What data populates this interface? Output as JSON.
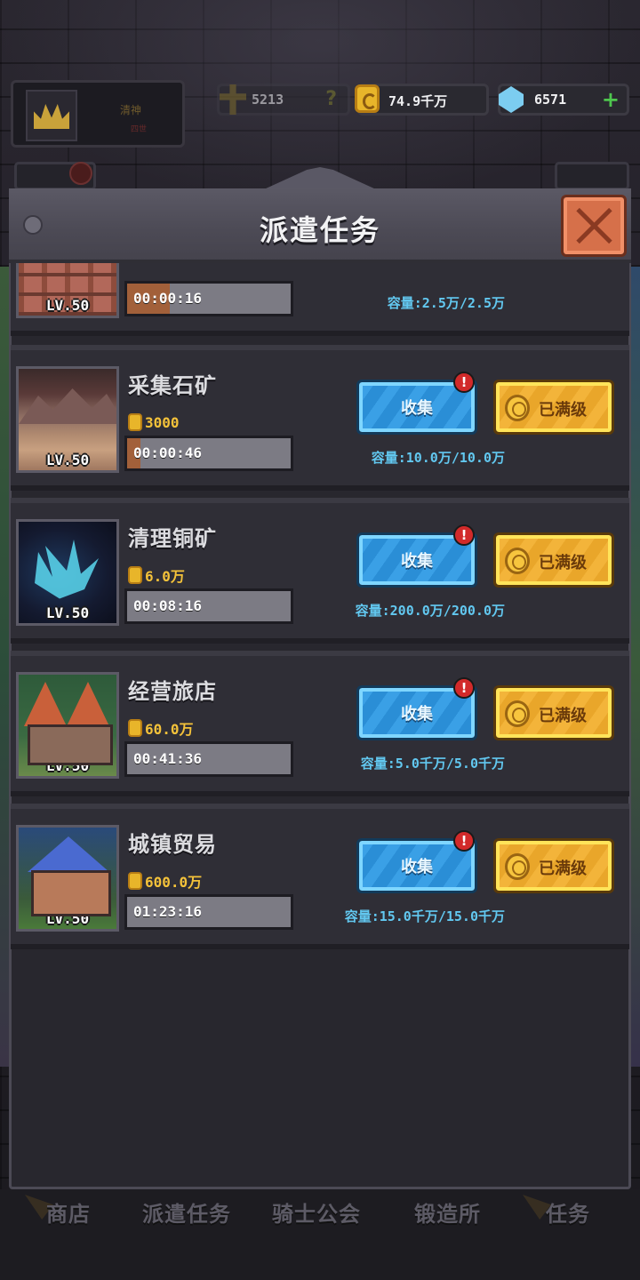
{
  "hud": {
    "profile_name": "清神",
    "profile_sub": "四世",
    "power": "5213",
    "gold": "74.9千万",
    "gems": "6571"
  },
  "modal": {
    "title": "派遣任务"
  },
  "tasks": [
    {
      "name": "",
      "level": "LV.50",
      "cost": "",
      "timer": "00:00:16",
      "timer_progress": 0.26,
      "capacity": "容量:2.5万/2.5万",
      "collect_label": "收集",
      "max_label": "已满级"
    },
    {
      "name": "采集石矿",
      "level": "LV.50",
      "cost": "3000",
      "timer": "00:00:46",
      "timer_progress": 0.08,
      "capacity": "容量:10.0万/10.0万",
      "collect_label": "收集",
      "max_label": "已满级"
    },
    {
      "name": "清理铜矿",
      "level": "LV.50",
      "cost": "6.0万",
      "timer": "00:08:16",
      "timer_progress": 0,
      "capacity": "容量:200.0万/200.0万",
      "collect_label": "收集",
      "max_label": "已满级"
    },
    {
      "name": "经营旅店",
      "level": "LV.50",
      "cost": "60.0万",
      "timer": "00:41:36",
      "timer_progress": 0,
      "capacity": "容量:5.0千万/5.0千万",
      "collect_label": "收集",
      "max_label": "已满级"
    },
    {
      "name": "城镇贸易",
      "level": "LV.50",
      "cost": "600.0万",
      "timer": "01:23:16",
      "timer_progress": 0,
      "capacity": "容量:15.0千万/15.0千万",
      "collect_label": "收集",
      "max_label": "已满级"
    }
  ],
  "nav": {
    "shop": "商店",
    "dispatch": "派遣任务",
    "guild": "骑士公会",
    "forge": "锻造所",
    "quests": "任务"
  },
  "colors": {
    "collect_button": "#2a8ed6",
    "max_button": "#e9a62a",
    "capacity_text": "#62c8f0",
    "cost_text": "#f4c23a",
    "alert": "#d22a2a",
    "close_button": "#d6704a"
  },
  "alert_badge": "!"
}
